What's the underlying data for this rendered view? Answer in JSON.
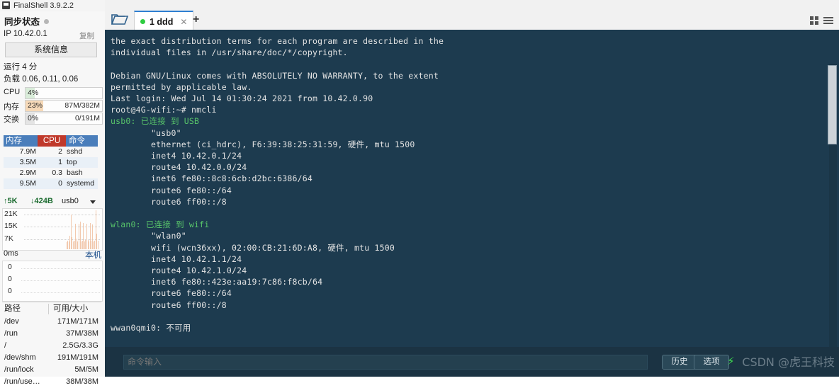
{
  "window": {
    "title": "FinalShell 3.9.2.2",
    "minimize_label": "—",
    "maximize_label": "",
    "close_label": "✕"
  },
  "sidebar": {
    "sync_status_label": "同步状态",
    "ip_label": "IP 10.42.0.1",
    "copy_label": "复制",
    "system_info_button": "系统信息",
    "uptime_label": "运行 4 分",
    "load_label": "负载 0.06, 0.11, 0.06",
    "meters": [
      {
        "name": "CPU",
        "pct_text": "4%",
        "value_text": "",
        "pct": 4,
        "color": "#d9ecd9"
      },
      {
        "name": "内存",
        "pct_text": "23%",
        "value_text": "87M/382M",
        "pct": 23,
        "color": "#f6d9b8"
      },
      {
        "name": "交换",
        "pct_text": "0%",
        "value_text": "0/191M",
        "pct": 0,
        "color": "#e4e4e4"
      }
    ],
    "process_table": {
      "headers": {
        "mem": "内存",
        "cpu": "CPU",
        "cmd": "命令"
      },
      "rows": [
        {
          "mem": "7.9M",
          "cpu": "2",
          "cmd": "sshd"
        },
        {
          "mem": "3.5M",
          "cpu": "1",
          "cmd": "top"
        },
        {
          "mem": "2.9M",
          "cpu": "0.3",
          "cmd": "bash"
        },
        {
          "mem": "9.5M",
          "cpu": "0",
          "cmd": "systemd"
        }
      ]
    },
    "network": {
      "upload": "5K",
      "download": "424B",
      "interface": "usb0",
      "up_arrow": "↑",
      "down_arrow": "↓",
      "y_labels": [
        "21K",
        "15K",
        "7K"
      ],
      "bars": [
        0,
        0,
        0,
        0,
        0,
        0,
        0,
        0,
        0,
        0,
        0,
        0,
        0,
        0,
        0,
        0,
        0,
        0,
        0,
        0,
        18,
        22,
        20,
        34,
        88,
        30,
        20,
        22,
        64,
        26,
        20,
        64,
        70,
        20,
        22,
        66,
        20,
        24,
        64,
        24,
        20,
        66,
        22,
        62,
        20,
        22,
        98,
        40,
        22
      ]
    },
    "latency": {
      "unit_label": "0ms",
      "host_label": "本机",
      "y_labels": [
        "0",
        "0",
        "0"
      ]
    },
    "disk": {
      "headers": {
        "path": "路径",
        "size": "可用/大小"
      },
      "rows": [
        {
          "path": "/dev",
          "size": "171M/171M"
        },
        {
          "path": "/run",
          "size": "37M/38M"
        },
        {
          "path": "/",
          "size": "2.5G/3.3G"
        },
        {
          "path": "/dev/shm",
          "size": "191M/191M"
        },
        {
          "path": "/run/lock",
          "size": "5M/5M"
        },
        {
          "path": "/run/use…",
          "size": "38M/38M"
        }
      ]
    }
  },
  "tabbar": {
    "tab_label": "1 ddd",
    "tab_close": "✕",
    "add_tab_label": "+"
  },
  "terminal": {
    "lines": [
      {
        "text": "the exact distribution terms for each program are described in the",
        "green": false
      },
      {
        "text": "individual files in /usr/share/doc/*/copyright.",
        "green": false
      },
      {
        "text": "",
        "green": false
      },
      {
        "text": "Debian GNU/Linux comes with ABSOLUTELY NO WARRANTY, to the extent",
        "green": false
      },
      {
        "text": "permitted by applicable law.",
        "green": false
      },
      {
        "text": "Last login: Wed Jul 14 01:30:24 2021 from 10.42.0.90",
        "green": false
      },
      {
        "text": "root@4G-wifi:~# nmcli",
        "green": false
      },
      {
        "text": "usb0: 已连接 到 USB",
        "green": true
      },
      {
        "text": "        \"usb0\"",
        "green": false
      },
      {
        "text": "        ethernet (ci_hdrc), F6:39:38:25:31:59, 硬件, mtu 1500",
        "green": false
      },
      {
        "text": "        inet4 10.42.0.1/24",
        "green": false
      },
      {
        "text": "        route4 10.42.0.0/24",
        "green": false
      },
      {
        "text": "        inet6 fe80::8c8:6cb:d2bc:6386/64",
        "green": false
      },
      {
        "text": "        route6 fe80::/64",
        "green": false
      },
      {
        "text": "        route6 ff00::/8",
        "green": false
      },
      {
        "text": "",
        "green": false
      },
      {
        "text": "wlan0: 已连接 到 wifi",
        "green": true
      },
      {
        "text": "        \"wlan0\"",
        "green": false
      },
      {
        "text": "        wifi (wcn36xx), 02:00:CB:21:6D:A8, 硬件, mtu 1500",
        "green": false
      },
      {
        "text": "        inet4 10.42.1.1/24",
        "green": false
      },
      {
        "text": "        route4 10.42.1.0/24",
        "green": false
      },
      {
        "text": "        inet6 fe80::423e:aa19:7c86:f8cb/64",
        "green": false
      },
      {
        "text": "        route6 fe80::/64",
        "green": false
      },
      {
        "text": "        route6 ff00::/8",
        "green": false
      },
      {
        "text": "",
        "green": false
      },
      {
        "text": "wwan0qmi0: 不可用",
        "green": false
      }
    ]
  },
  "command_bar": {
    "placeholder": "命令输入",
    "value": "",
    "history_button": "历史",
    "options_button": "选项",
    "bolt_icon": "⚡",
    "watermark": "CSDN @虎王科技"
  },
  "colors": {
    "terminal_bg": "#1d3b4f",
    "accent_blue": "#2f7fd1",
    "green_status": "#58c46a",
    "cpu_header_red": "#c0392b",
    "table_header_blue": "#4a7ebb"
  }
}
